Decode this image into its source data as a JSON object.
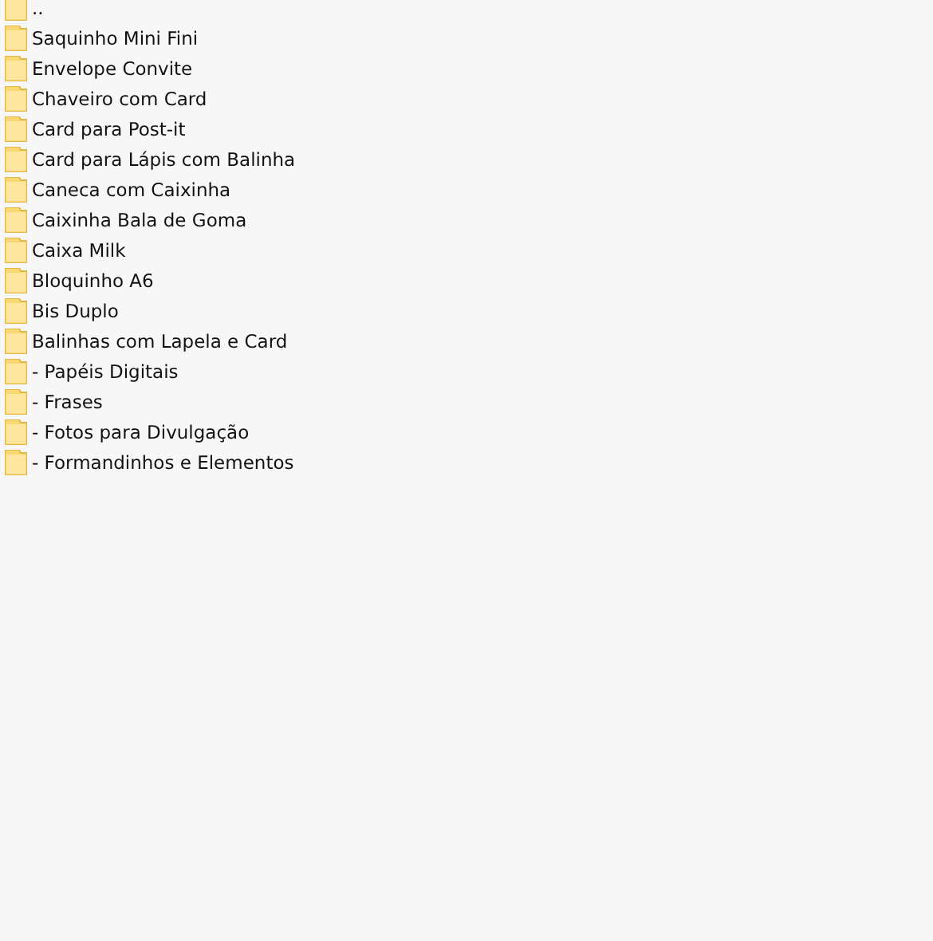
{
  "folders": [
    {
      "name": ".."
    },
    {
      "name": "Saquinho Mini Fini"
    },
    {
      "name": "Envelope Convite"
    },
    {
      "name": "Chaveiro com Card"
    },
    {
      "name": "Card para Post-it"
    },
    {
      "name": "Card para Lápis com Balinha"
    },
    {
      "name": "Caneca com Caixinha"
    },
    {
      "name": "Caixinha Bala de Goma"
    },
    {
      "name": "Caixa Milk"
    },
    {
      "name": "Bloquinho A6"
    },
    {
      "name": "Bis Duplo"
    },
    {
      "name": "Balinhas com Lapela e Card"
    },
    {
      "name": "- Papéis Digitais"
    },
    {
      "name": "- Frases"
    },
    {
      "name": "- Fotos para Divulgação"
    },
    {
      "name": "- Formandinhos e Elementos"
    }
  ]
}
